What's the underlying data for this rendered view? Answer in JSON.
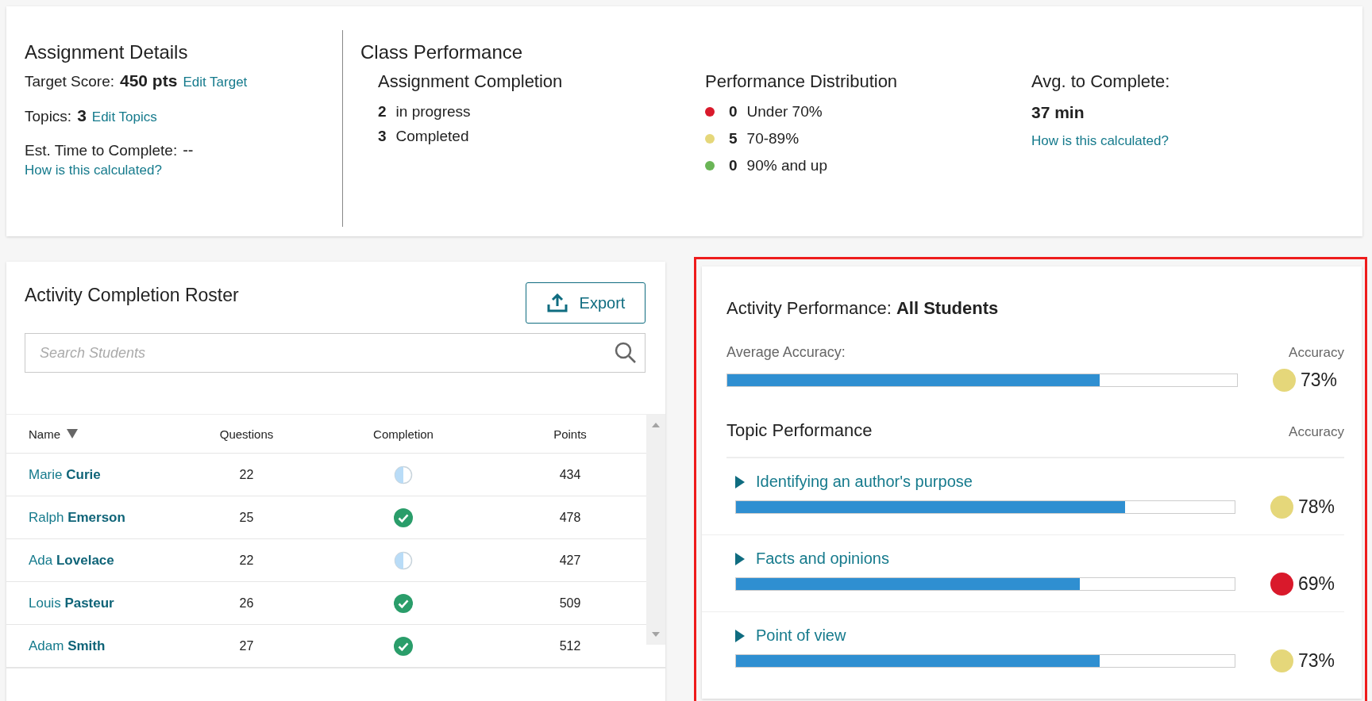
{
  "assignment_details": {
    "title": "Assignment Details",
    "target_score": {
      "label": "Target Score:",
      "value": "450 pts",
      "link": "Edit Target"
    },
    "topics": {
      "label": "Topics:",
      "value": "3",
      "link": "Edit Topics"
    },
    "est_time": {
      "label": "Est. Time to Complete:",
      "value": "--",
      "link": "How is this calculated?"
    }
  },
  "class_performance": {
    "title": "Class Performance",
    "completion": {
      "title": "Assignment Completion",
      "items": [
        {
          "count": "2",
          "label": "in progress"
        },
        {
          "count": "3",
          "label": "Completed"
        }
      ]
    },
    "distribution": {
      "title": "Performance Distribution",
      "items": [
        {
          "color": "#d9192b",
          "count": "0",
          "label": "Under 70%"
        },
        {
          "color": "#e5d77a",
          "count": "5",
          "label": "70-89%"
        },
        {
          "color": "#6ab556",
          "count": "0",
          "label": "90% and up"
        }
      ]
    },
    "avg": {
      "title": "Avg. to Complete:",
      "value": "37 min",
      "link": "How is this calculated?"
    }
  },
  "roster": {
    "title": "Activity Completion Roster",
    "export_button": "Export",
    "search": {
      "placeholder": "Search Students"
    },
    "columns": [
      "Name",
      "Questions",
      "Completion",
      "Points"
    ],
    "rows": [
      {
        "name": "Marie **Curie**",
        "questions": "22",
        "kind": "partial",
        "points": "434"
      },
      {
        "name": "Ralph **Emerson**",
        "questions": "25",
        "kind": "complete",
        "points": "478"
      },
      {
        "name": "Ada **Lovelace**",
        "questions": "22",
        "kind": "partial",
        "points": "427"
      },
      {
        "name": "Louis **Pasteur**",
        "questions": "26",
        "kind": "complete",
        "points": "509"
      },
      {
        "name": "Adam **Smith**",
        "questions": "27",
        "kind": "complete",
        "points": "512"
      }
    ]
  },
  "activity_performance": {
    "highlighted": true,
    "title": "Activity Performance: **All Students**",
    "average": {
      "label": "Average Accuracy:",
      "column": "Accuracy",
      "level": 0.73,
      "color": "#e5d77a",
      "value": "73%"
    },
    "topic_title": "Topic Performance",
    "topic_column": "Accuracy",
    "topics": [
      {
        "name": "Identifying an author's purpose",
        "expanded": false,
        "level": 0.78,
        "color": "#e5d77a",
        "value": "78%"
      },
      {
        "name": "Facts and opinions",
        "expanded": false,
        "level": 0.69,
        "color": "#d9192b",
        "value": "69%"
      },
      {
        "name": "Point of view",
        "expanded": false,
        "level": 0.73,
        "color": "#e5d77a",
        "value": "73%"
      }
    ]
  }
}
